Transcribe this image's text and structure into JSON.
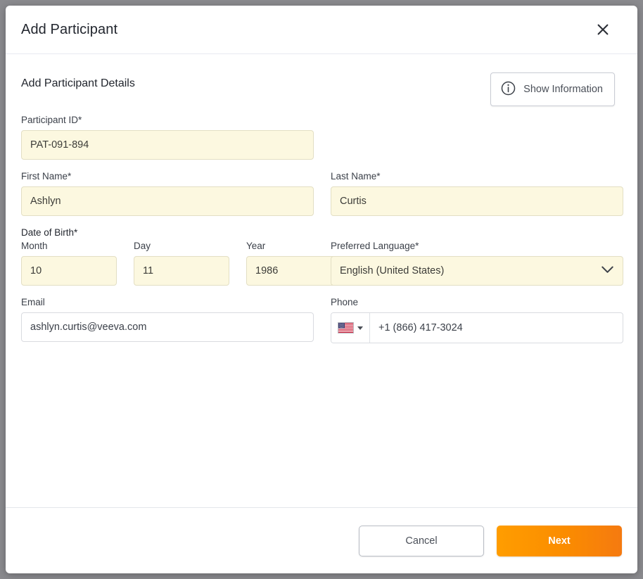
{
  "dialog": {
    "title": "Add Participant",
    "close_icon": "close-icon"
  },
  "body": {
    "section_title": "Add Participant Details",
    "show_information": {
      "label": "Show Information",
      "icon": "info-circle-icon"
    }
  },
  "fields": {
    "participant_id": {
      "label": "Participant ID*",
      "value": "PAT-091-894",
      "placeholder": ""
    },
    "first_name": {
      "label": "First Name*",
      "value": "Ashlyn",
      "placeholder": ""
    },
    "last_name": {
      "label": "Last Name*",
      "value": "Curtis",
      "placeholder": ""
    },
    "date_of_birth": {
      "label": "Date of Birth*",
      "month": {
        "label": "Month",
        "value": "10",
        "placeholder": ""
      },
      "day": {
        "label": "Day",
        "value": "11",
        "placeholder": ""
      },
      "year": {
        "label": "Year",
        "value": "1986",
        "placeholder": ""
      }
    },
    "preferred_language": {
      "label": "Preferred Language*",
      "value": "English (United States)",
      "chevron_icon": "chevron-down-icon"
    },
    "email": {
      "label": "Email",
      "value": "ashlyn.curtis@veeva.com",
      "placeholder": ""
    },
    "phone": {
      "label": "Phone",
      "country_flag": "us-flag-icon",
      "value": "+1 (866) 417-3024",
      "placeholder": ""
    }
  },
  "footer": {
    "cancel_label": "Cancel",
    "next_label": "Next"
  },
  "colors": {
    "required_field_background": "#FCF8E0",
    "primary_button_start": "#FF9D00",
    "primary_button_end": "#F57A10",
    "title_text": "#22262E"
  }
}
